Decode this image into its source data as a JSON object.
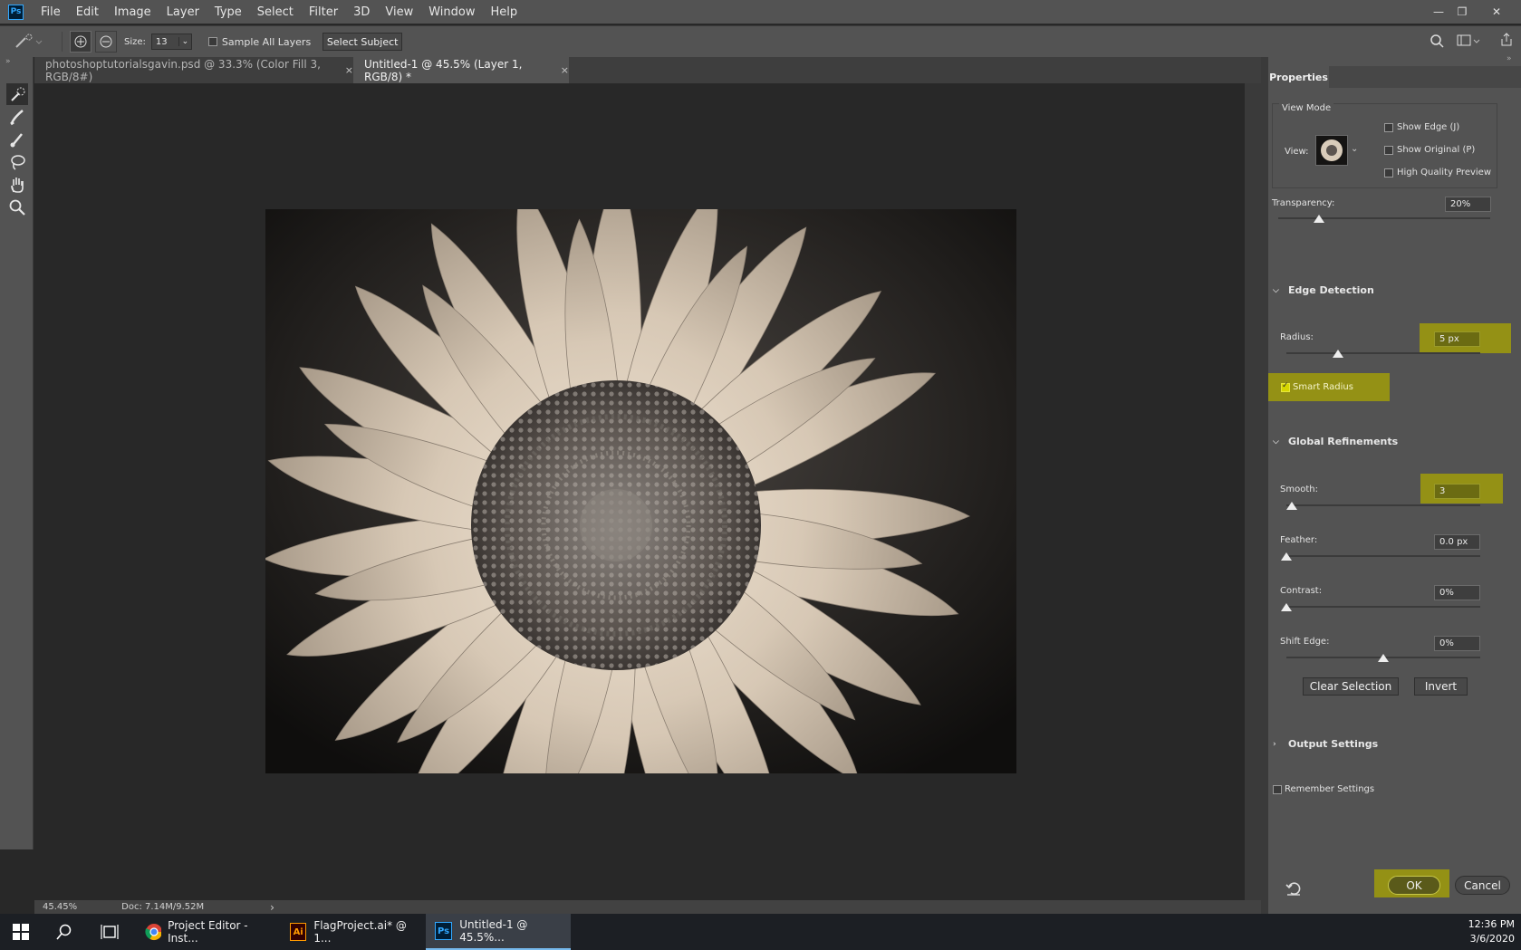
{
  "menubar": {
    "items": [
      "File",
      "Edit",
      "Image",
      "Layer",
      "Type",
      "Select",
      "Filter",
      "3D",
      "View",
      "Window",
      "Help"
    ],
    "logo": "Ps"
  },
  "options": {
    "size_label": "Size:",
    "size_value": "13",
    "sample_all_layers": "Sample All Layers",
    "select_subject": "Select Subject"
  },
  "tabs": [
    {
      "label": "photoshoptutorialsgavin.psd @ 33.3% (Color Fill 3, RGB/8#)",
      "close": "×"
    },
    {
      "label": "Untitled-1 @ 45.5% (Layer 1, RGB/8) *",
      "close": "×"
    }
  ],
  "status": {
    "zoom": "45.45%",
    "doc": "Doc: 7.14M/9.52M",
    "arrow": "›"
  },
  "properties": {
    "tab": "Properties",
    "view_mode": {
      "title": "View Mode",
      "view_label": "View:",
      "show_edge": "Show Edge (J)",
      "show_original": "Show Original (P)",
      "high_quality": "High Quality Preview"
    },
    "transparency": {
      "label": "Transparency:",
      "value": "20%"
    },
    "edge_detection": {
      "title": "Edge Detection",
      "radius_label": "Radius:",
      "radius_value": "5 px",
      "smart_radius": "Smart Radius"
    },
    "global_refinements": {
      "title": "Global Refinements",
      "smooth_label": "Smooth:",
      "smooth_value": "3",
      "feather_label": "Feather:",
      "feather_value": "0.0 px",
      "contrast_label": "Contrast:",
      "contrast_value": "0%",
      "shift_edge_label": "Shift Edge:",
      "shift_edge_value": "0%"
    },
    "clear_selection": "Clear Selection",
    "invert": "Invert",
    "output_settings": "Output Settings",
    "remember_settings": "Remember Settings",
    "ok": "OK",
    "cancel": "Cancel"
  },
  "taskbar": {
    "items": [
      {
        "label": "Project Editor - Inst..."
      },
      {
        "label": "FlagProject.ai* @ 1..."
      },
      {
        "label": "Untitled-1 @ 45.5%..."
      }
    ],
    "time": "12:36 PM",
    "date": "3/6/2020"
  },
  "colors": {
    "highlight": "#aaa600",
    "panel": "#535353",
    "canvas_bg": "#282828"
  }
}
